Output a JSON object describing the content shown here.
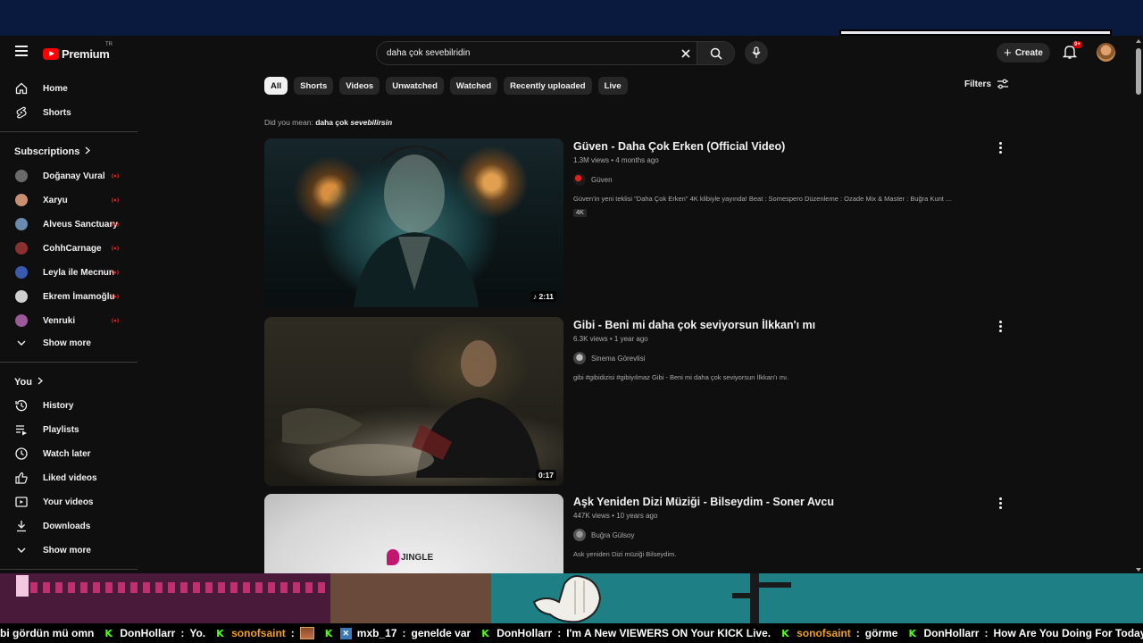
{
  "masthead": {
    "logo_text": "Premium",
    "country_code": "TR",
    "search_query": "daha çok sevebilridin",
    "create_label": "Create",
    "notifications_badge": "9+"
  },
  "sidebar": {
    "main": [
      {
        "label": "Home",
        "icon": "home-icon"
      },
      {
        "label": "Shorts",
        "icon": "shorts-icon"
      }
    ],
    "subscriptions_header": "Subscriptions",
    "subscriptions": [
      {
        "label": "Doğanay Vural",
        "color": "#6a6a6a"
      },
      {
        "label": "Xaryu",
        "color": "#c89070"
      },
      {
        "label": "Alveus Sanctuary",
        "color": "#6a8ab0"
      },
      {
        "label": "CohhCarnage",
        "color": "#8a3030"
      },
      {
        "label": "Leyla ile Mecnun",
        "color": "#3a5ab0"
      },
      {
        "label": "Ekrem İmamoğlu",
        "color": "#d0d0d0"
      },
      {
        "label": "Venruki",
        "color": "#9a5a9a"
      }
    ],
    "show_more_1": "Show more",
    "you_header": "You",
    "you": [
      {
        "label": "History",
        "icon": "history-icon"
      },
      {
        "label": "Playlists",
        "icon": "playlists-icon"
      },
      {
        "label": "Watch later",
        "icon": "watch-later-icon"
      },
      {
        "label": "Liked videos",
        "icon": "liked-icon"
      },
      {
        "label": "Your videos",
        "icon": "your-videos-icon"
      },
      {
        "label": "Downloads",
        "icon": "download-icon"
      }
    ],
    "show_more_2": "Show more"
  },
  "chips": [
    "All",
    "Shorts",
    "Videos",
    "Unwatched",
    "Watched",
    "Recently uploaded",
    "Live"
  ],
  "filters_label": "Filters",
  "did_you_mean": {
    "prefix": "Did you mean:",
    "correction_plain": "daha çok",
    "correction_italic": "sevebilirsin"
  },
  "results": [
    {
      "title": "Güven - Daha Çok Erken (Official Video)",
      "stats": "1.3M views • 4 months ago",
      "channel": "Güven",
      "description": "Güven'in yeni teklisi \"Daha Çok Erken\" 4K klibiyle yayında! Beat : Somespero Düzenleme : Ozade Mix & Master : Buğra Kunt ...",
      "badge": "4K",
      "duration": "♪ 2:11",
      "accent": "#2a9aa0"
    },
    {
      "title": "Gibi - Beni mi daha çok seviyorsun İlkkan'ı mı",
      "stats": "6.3K views • 1 year ago",
      "channel": "Sinema Görevlisi",
      "description": "gibi #gibidizisi #gibiyılmaz Gibi - Beni mi daha çok seviyorsun İlkkan'ı mı.",
      "badge": "",
      "duration": "0:17",
      "accent": "#5a5a40"
    },
    {
      "title": "Aşk Yeniden Dizi Müziği - Bilseydim - Soner Avcu",
      "stats": "447K views • 10 years ago",
      "channel": "Buğra Gülsoy",
      "description": "Ask yeniden Dizi müziği Bilseydim.",
      "badge": "",
      "duration": "",
      "thumb_text": "JINGLE",
      "accent": "#c01870"
    }
  ],
  "ticker": [
    {
      "user": "",
      "msg": "bi gördün mü omn"
    },
    {
      "user": "DonHollarr",
      "msg": "Yo.",
      "color": "white"
    },
    {
      "user": "sonofsaint",
      "msg": "",
      "color": "orange",
      "emote": true
    },
    {
      "user": "mxb_17",
      "msg": "genelde var",
      "color": "white",
      "prefix_emote": true
    },
    {
      "user": "DonHollarr",
      "msg": "I'm A New VIEWERS ON Your KICK Live.",
      "color": "white"
    },
    {
      "user": "sonofsaint",
      "msg": "görme",
      "color": "orange"
    },
    {
      "user": "DonHollarr",
      "msg": "How Are You Doing For Today.",
      "color": "white"
    }
  ]
}
